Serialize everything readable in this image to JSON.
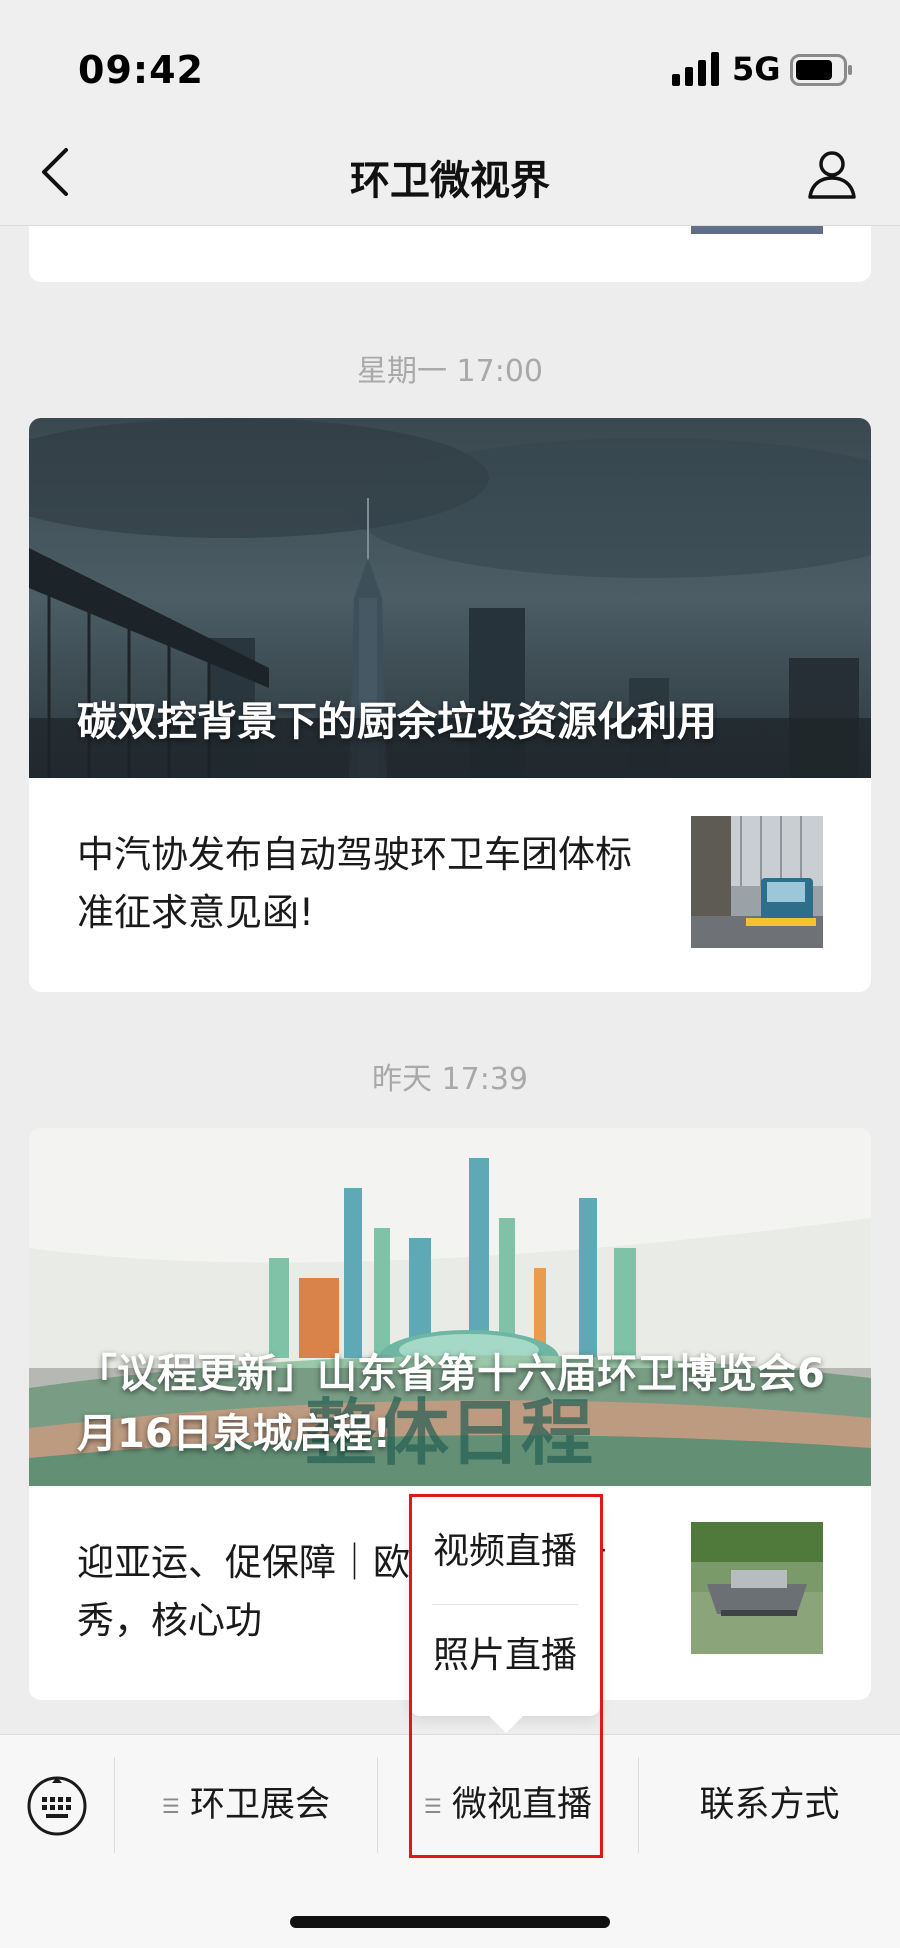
{
  "status_bar": {
    "time": "09:42",
    "network": "5G",
    "icons": [
      "signal-icon",
      "battery-icon"
    ]
  },
  "nav": {
    "title": "环卫微视界",
    "back_icon": "back-chevron-icon",
    "profile_icon": "profile-icon"
  },
  "feed": [
    {
      "timestamp": "星期一 17:00",
      "hero_title": "碳双控背景下的厨余垃圾资源化利用",
      "sub_article": "中汽协发布自动驾驶环卫车团体标准征求意见函!"
    },
    {
      "timestamp": "昨天 17:39",
      "hero_title": "「议程更新」山东省第十六届环卫博览会6月16日泉城启程!",
      "hero_watermark": "整体日程",
      "sub_article": "迎亚运、促保障｜欧 杭州公开首秀，核心功"
    }
  ],
  "popup_menu": {
    "items": [
      "视频直播",
      "照片直播"
    ]
  },
  "bottom_menu": {
    "keyboard_icon": "keyboard-icon",
    "items": [
      "环卫展会",
      "微视直播",
      "联系方式"
    ]
  },
  "colors": {
    "highlight": "#e01818",
    "background": "#ededed"
  }
}
